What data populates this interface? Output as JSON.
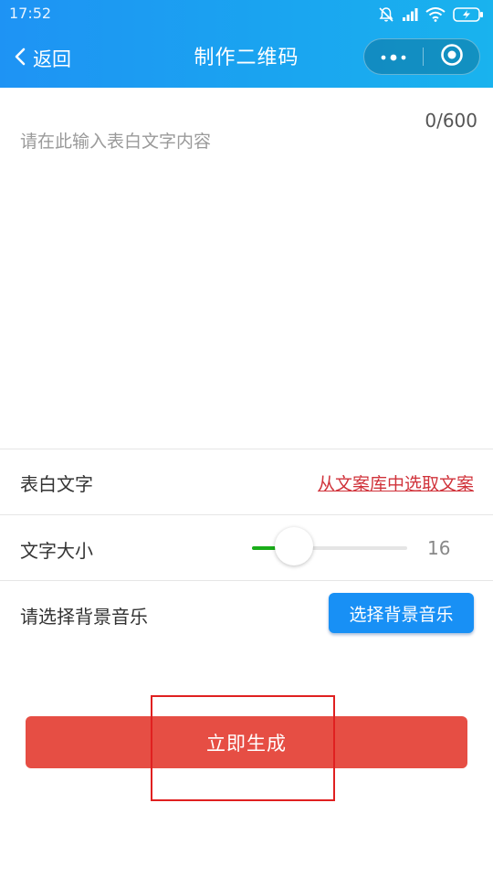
{
  "status_bar": {
    "time": "17:52",
    "icons": [
      "mute-bell-icon",
      "signal-icon",
      "wifi-icon",
      "battery-charging-icon"
    ]
  },
  "nav": {
    "back_label": "返回",
    "title": "制作二维码",
    "capsule": {
      "more_icon": "more-dots-icon",
      "close_icon": "target-close-icon"
    }
  },
  "editor": {
    "placeholder": "请在此输入表白文字内容",
    "counter": "0/600"
  },
  "confession_row": {
    "label": "表白文字",
    "link": "从文案库中选取文案"
  },
  "font_size_row": {
    "label": "文字大小",
    "value": "16",
    "slider_fraction": 0.27
  },
  "music_row": {
    "label": "请选择背景音乐",
    "button": "选择背景音乐"
  },
  "generate_button": "立即生成",
  "colors": {
    "header_gradient_start": "#1e93f4",
    "header_gradient_end": "#19b3ee",
    "link_red": "#d0323a",
    "slider_green": "#1aad19",
    "primary_blue": "#1890f5",
    "generate_red": "#e64e44",
    "highlight_box": "#e02020"
  }
}
